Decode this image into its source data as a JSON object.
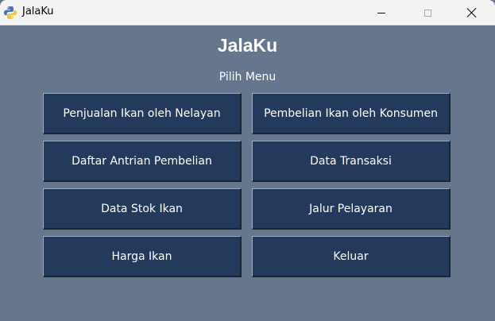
{
  "window": {
    "title": "JalaKu",
    "app_icon": "python-icon",
    "controls": {
      "minimize_icon": "minimize-icon",
      "maximize_icon": "maximize-icon",
      "close_icon": "close-icon"
    }
  },
  "main": {
    "heading": "JalaKu",
    "subheading": "Pilih Menu",
    "menu": [
      "Penjualan Ikan oleh Nelayan",
      "Pembelian Ikan oleh Konsumen",
      "Daftar Antrian Pembelian",
      "Data Transaksi",
      "Data Stok Ikan",
      "Jalur Pelayaran",
      "Harga Ikan",
      "Keluar"
    ]
  },
  "colors": {
    "background": "#66768c",
    "button": "#243a5d",
    "text": "#ffffff",
    "titlebar": "#f3f3f3"
  }
}
